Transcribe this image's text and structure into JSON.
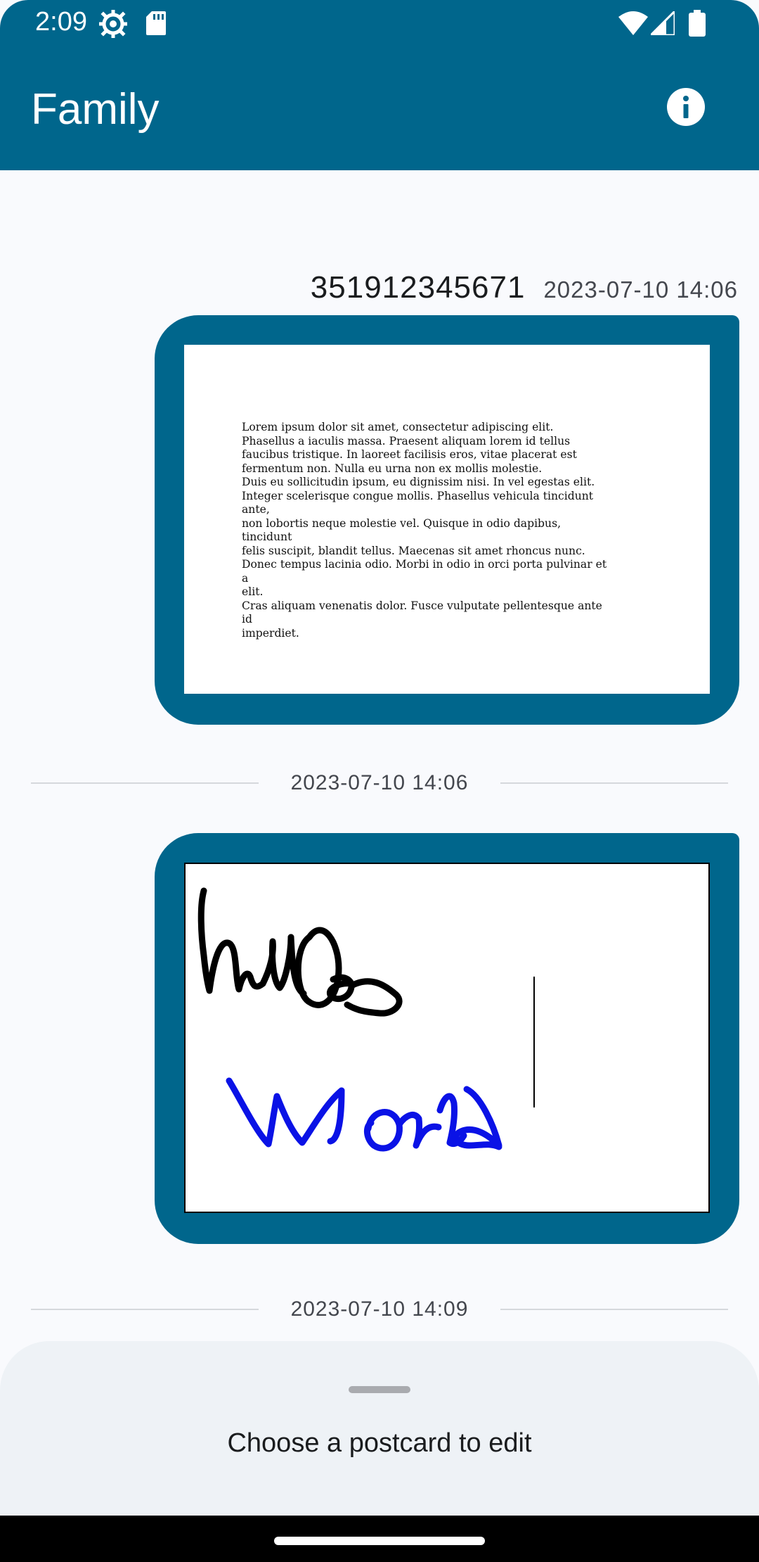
{
  "status_bar": {
    "time": "2:09",
    "icons": [
      "settings-gear-icon",
      "sd-card-icon",
      "wifi-icon",
      "cell-signal-icon",
      "battery-icon"
    ]
  },
  "app_bar": {
    "title": "Family",
    "action_icon": "info-icon"
  },
  "colors": {
    "primary": "#00668C",
    "background": "#F9FAFD",
    "sheet": "#EEF2F6",
    "ink_black": "#000000",
    "ink_blue": "#0A12E6"
  },
  "messages": [
    {
      "sender": "351912345671",
      "time": "2023-07-10 14:06",
      "postcard_type": "text",
      "text_lines": [
        "Lorem ipsum dolor sit amet, consectetur adipiscing elit.",
        "Phasellus a iaculis massa. Praesent aliquam lorem id tellus",
        "faucibus tristique. In laoreet facilisis eros, vitae placerat est",
        "fermentum non. Nulla eu urna non ex mollis molestie.",
        "Duis eu sollicitudin ipsum, eu dignissim nisi. In vel egestas elit.",
        "Integer scelerisque congue mollis. Phasellus vehicula tincidunt ante,",
        "non lobortis neque molestie vel. Quisque in odio dapibus, tincidunt",
        "felis suscipit, blandit tellus. Maecenas sit amet rhoncus nunc.",
        "Donec tempus lacinia odio. Morbi in odio in orci porta pulvinar et a",
        "elit.",
        "Cras aliquam venenatis dolor. Fusce vulputate pellentesque ante id",
        "imperdiet."
      ]
    },
    {
      "divider_time": "2023-07-10 14:06",
      "postcard_type": "drawing",
      "drawing_text": [
        "hello",
        "World"
      ]
    }
  ],
  "divider_last": "2023-07-10 14:09",
  "bottom_sheet": {
    "text": "Choose a postcard to edit"
  }
}
